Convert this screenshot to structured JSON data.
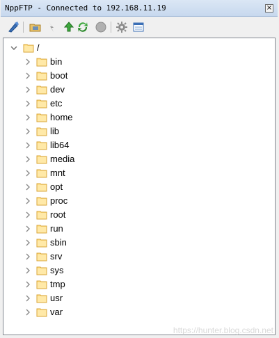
{
  "window": {
    "title": "NppFTP - Connected to 192.168.11.19",
    "close_glyph": "×"
  },
  "toolbar": {
    "buttons": [
      {
        "name": "connect-icon",
        "enabled": true
      },
      {
        "name": "open-directory-icon",
        "enabled": true
      },
      {
        "name": "download-icon",
        "enabled": false
      },
      {
        "name": "upload-icon",
        "enabled": true
      },
      {
        "name": "refresh-icon",
        "enabled": true
      },
      {
        "name": "abort-icon",
        "enabled": false
      },
      {
        "name": "settings-icon",
        "enabled": true
      },
      {
        "name": "message-window-icon",
        "enabled": true
      }
    ]
  },
  "tree": {
    "root": {
      "label": "/",
      "expanded": true
    },
    "items": [
      {
        "label": "bin"
      },
      {
        "label": "boot"
      },
      {
        "label": "dev"
      },
      {
        "label": "etc"
      },
      {
        "label": "home"
      },
      {
        "label": "lib"
      },
      {
        "label": "lib64"
      },
      {
        "label": "media"
      },
      {
        "label": "mnt"
      },
      {
        "label": "opt"
      },
      {
        "label": "proc"
      },
      {
        "label": "root"
      },
      {
        "label": "run"
      },
      {
        "label": "sbin"
      },
      {
        "label": "srv"
      },
      {
        "label": "sys"
      },
      {
        "label": "tmp"
      },
      {
        "label": "usr"
      },
      {
        "label": "var"
      }
    ]
  },
  "watermark": "https://hunter.blog.csdn.net",
  "colors": {
    "folder_fill": "#ffe08a",
    "folder_stroke": "#d9a63a",
    "chevron": "#7a7a7a",
    "titlebar": "#c7d8ee"
  }
}
